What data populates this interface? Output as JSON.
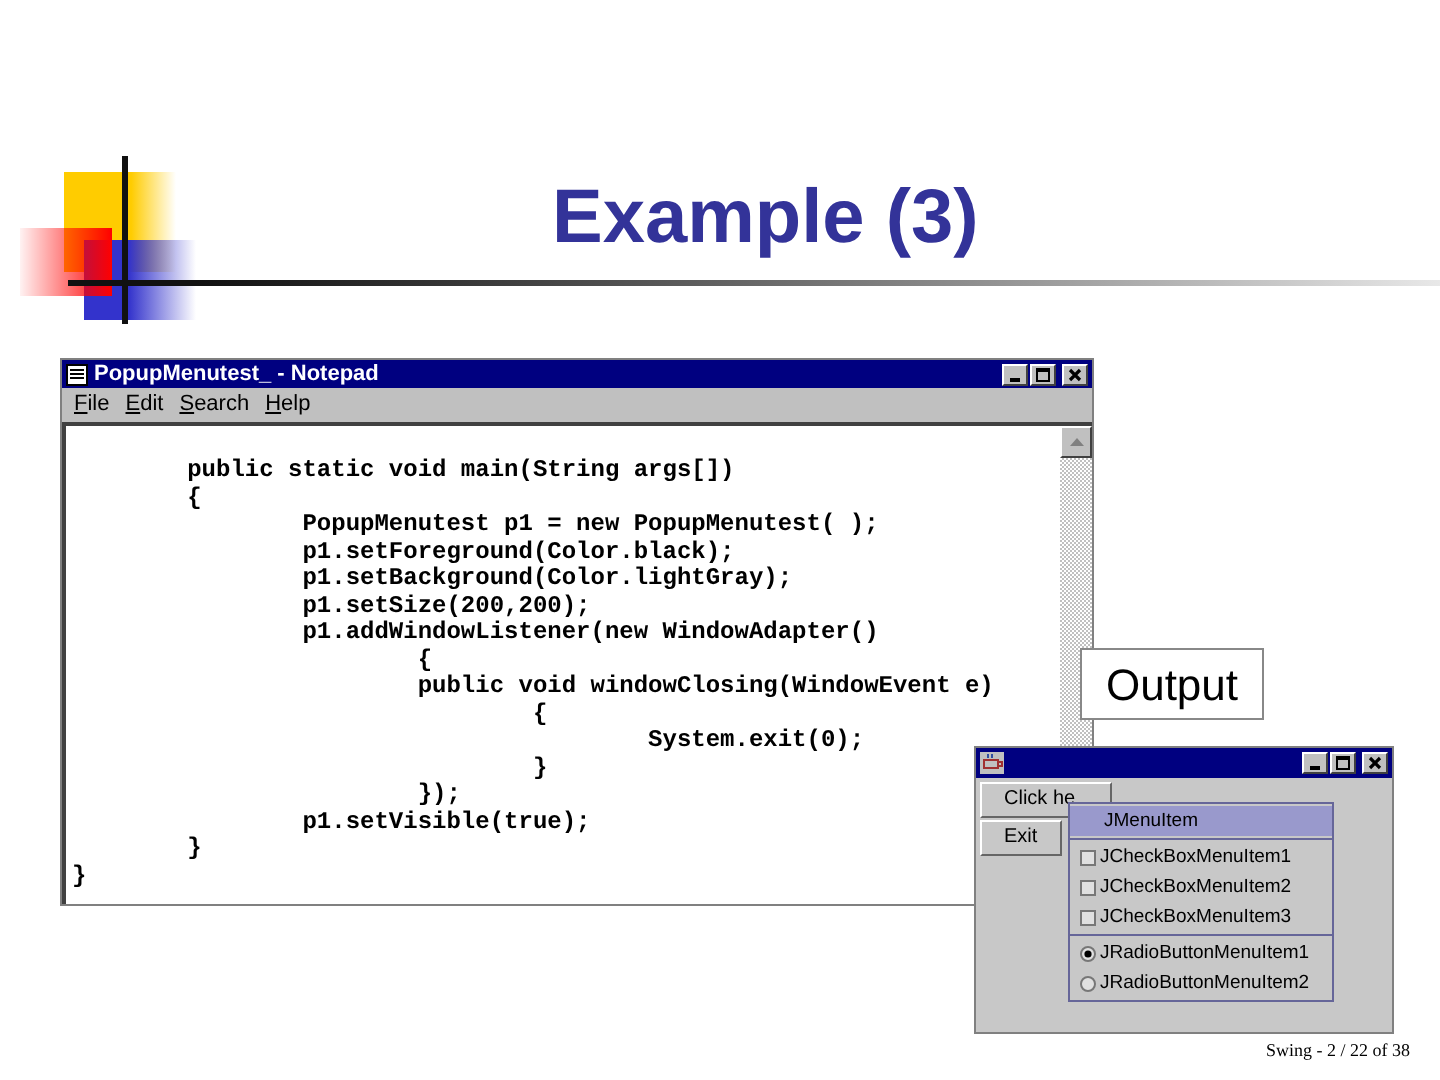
{
  "slide": {
    "title": "Example (3)",
    "output_label": "Output",
    "footer": "Swing - 2 / 22 of 38"
  },
  "notepad": {
    "title": "PopupMenutest_ - Notepad",
    "menu": [
      "File",
      "Edit",
      "Search",
      "Help"
    ],
    "lines": [
      "\tpublic static void main(String args[])",
      "\t{",
      "\t\tPopupMenutest p1 = new PopupMenutest( );",
      "\t\tp1.setForeground(Color.black);",
      "\t\tp1.setBackground(Color.lightGray);",
      "\t\tp1.setSize(200,200);",
      "\t\tp1.addWindowListener(new WindowAdapter()",
      "\t\t\t{",
      "\t\t\tpublic void windowClosing(WindowEvent e)",
      "\t\t\t\t{",
      "\t\t\t\t\tSystem.exit(0);",
      "\t\t\t\t}",
      "\t\t\t});",
      "\t\tp1.setVisible(true);",
      "\t}",
      "}"
    ]
  },
  "app_window": {
    "buttons": [
      "Click he",
      "Exit"
    ],
    "popup_menu": [
      {
        "kind": "item",
        "label": "JMenuItem",
        "highlighted": true
      },
      {
        "kind": "separator"
      },
      {
        "kind": "check",
        "label": "JCheckBoxMenuItem1",
        "highlighted": false,
        "checked": false
      },
      {
        "kind": "check",
        "label": "JCheckBoxMenuItem2",
        "highlighted": false,
        "checked": false
      },
      {
        "kind": "check",
        "label": "JCheckBoxMenuItem3",
        "highlighted": false,
        "checked": false
      },
      {
        "kind": "separator"
      },
      {
        "kind": "radio",
        "label": "JRadioButtonMenuItem1",
        "highlighted": false,
        "selected": true
      },
      {
        "kind": "radio",
        "label": "JRadioButtonMenuItem2",
        "highlighted": false,
        "selected": false
      }
    ]
  }
}
